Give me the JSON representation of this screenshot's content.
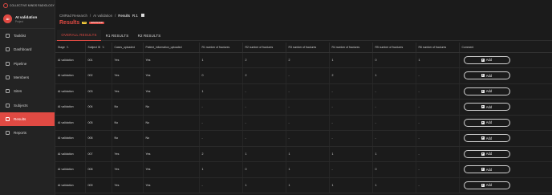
{
  "brand": {
    "name": "COLLECTIVE MINDS RADIOLOGY"
  },
  "project": {
    "title": "AI validation",
    "subtitle": "Project",
    "initials": "AI"
  },
  "sidebar": {
    "items": [
      {
        "label": "Tasklist",
        "icon": "tasklist-icon",
        "active": false
      },
      {
        "label": "Dashboard",
        "icon": "dashboard-icon",
        "active": false
      },
      {
        "label": "Pipeline",
        "icon": "pipeline-icon",
        "active": false
      },
      {
        "label": "Members",
        "icon": "members-icon",
        "active": false
      },
      {
        "label": "Sites",
        "icon": "sites-icon",
        "active": false
      },
      {
        "label": "Subjects",
        "icon": "subjects-icon",
        "active": false
      },
      {
        "label": "Results",
        "icon": "results-icon",
        "active": true
      },
      {
        "label": "Reports",
        "icon": "reports-icon",
        "active": false
      }
    ]
  },
  "header": {
    "breadcrumbs": [
      "CMRad Research",
      "AI validation",
      "Results"
    ],
    "breadcrumb_version": "R.1",
    "title": "Results",
    "badges": [
      "R1",
      "ANNOTATION"
    ]
  },
  "tabs": [
    "OVERALL RESULTS",
    "R1 RESULTS",
    "R2 RESULTS"
  ],
  "table": {
    "columns": [
      "Stage",
      "Subject ID",
      "Cases_uploaded",
      "Patient_information_uploaded",
      "R1 number of fractures",
      "R2 number of fractures",
      "R3 number of fractures",
      "R4 number of fractures",
      "R5 number of fractures",
      "R6 number of fractures",
      "Comment"
    ],
    "add_label": "Add",
    "rows": [
      [
        "AI validation",
        "001",
        "Yes",
        "Yes",
        "1",
        "2",
        "2",
        "1",
        "0",
        "1"
      ],
      [
        "AI validation",
        "002",
        "Yes",
        "Yes",
        "0",
        "2",
        "-",
        "2",
        "1",
        "-"
      ],
      [
        "AI validation",
        "003",
        "Yes",
        "Yes",
        "1",
        "-",
        "-",
        "-",
        "-",
        "-"
      ],
      [
        "AI validation",
        "004",
        "No",
        "No",
        "-",
        "-",
        "-",
        "-",
        "-",
        "-"
      ],
      [
        "AI validation",
        "005",
        "No",
        "No",
        "-",
        "-",
        "-",
        "-",
        "-",
        "-"
      ],
      [
        "AI validation",
        "006",
        "No",
        "No",
        "-",
        "-",
        "-",
        "-",
        "-",
        "-"
      ],
      [
        "AI validation",
        "007",
        "Yes",
        "Yes",
        "2",
        "1",
        "1",
        "1",
        "1",
        "-"
      ],
      [
        "AI validation",
        "008",
        "Yes",
        "Yes",
        "1",
        "0",
        "1",
        "-",
        "0",
        "-"
      ],
      [
        "AI validation",
        "009",
        "Yes",
        "Yes",
        "-",
        "1",
        "1",
        "1",
        "1",
        "-"
      ]
    ]
  },
  "colors": {
    "accent": "#e04a43",
    "background": "#1b1b1b",
    "sidebar": "#232323"
  }
}
